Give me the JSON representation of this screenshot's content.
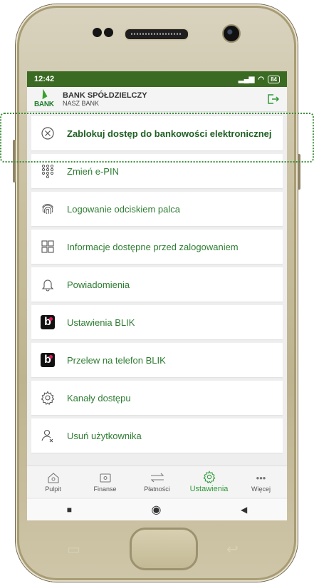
{
  "status": {
    "time": "12:42",
    "battery": "84"
  },
  "bank": {
    "name_line1": "BANK SPÓŁDZIELCZY",
    "name_line2": "NASZ BANK",
    "logo_text": "BANK"
  },
  "menu": [
    {
      "label": "Zablokuj dostęp do bankowości elektronicznej",
      "icon": "x-circle-icon"
    },
    {
      "label": "Zmień e-PIN",
      "icon": "keypad-icon"
    },
    {
      "label": "Logowanie odciskiem palca",
      "icon": "fingerprint-icon"
    },
    {
      "label": "Informacje dostępne przed zalogowaniem",
      "icon": "grid-icon"
    },
    {
      "label": "Powiadomienia",
      "icon": "bell-icon"
    },
    {
      "label": "Ustawienia BLIK",
      "icon": "blik-icon"
    },
    {
      "label": "Przelew na telefon BLIK",
      "icon": "blik-icon"
    },
    {
      "label": "Kanały dostępu",
      "icon": "gear-icon"
    },
    {
      "label": "Usuń użytkownika",
      "icon": "user-remove-icon"
    }
  ],
  "nav": [
    {
      "label": "Pulpit",
      "icon": "home-icon"
    },
    {
      "label": "Finanse",
      "icon": "wallet-icon"
    },
    {
      "label": "Płatności",
      "icon": "transfer-icon"
    },
    {
      "label": "Ustawienia",
      "icon": "gear-icon",
      "active": true
    },
    {
      "label": "Więcej",
      "icon": "more-icon"
    }
  ],
  "colors": {
    "accent": "#2e9a3a",
    "statusbar": "#3b6b23",
    "text_green": "#2e7d32"
  }
}
